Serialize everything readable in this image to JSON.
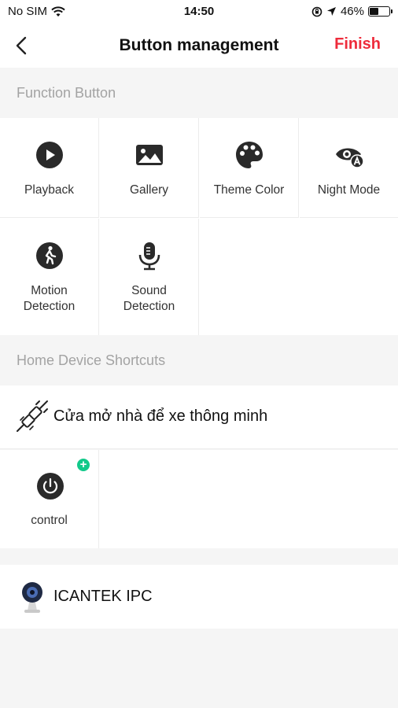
{
  "status_bar": {
    "carrier": "No SIM",
    "time": "14:50",
    "battery_percent": "46%",
    "battery_level": 0.46
  },
  "nav": {
    "title": "Button management",
    "finish_label": "Finish"
  },
  "function_section": {
    "header": "Function Button",
    "buttons": [
      {
        "label": "Playback",
        "icon": "play-icon"
      },
      {
        "label": "Gallery",
        "icon": "image-icon"
      },
      {
        "label": "Theme Color",
        "icon": "palette-icon"
      },
      {
        "label": "Night Mode",
        "icon": "night-mode-icon"
      },
      {
        "label": "Motion\nDetection",
        "icon": "motion-icon"
      },
      {
        "label": "Sound\nDetection",
        "icon": "microphone-icon"
      }
    ]
  },
  "shortcuts_section": {
    "header": "Home Device Shortcuts",
    "devices": [
      {
        "name": "Cửa mở nhà để xe thông minh",
        "icon": "plug-icon",
        "controls": [
          {
            "label": "control",
            "icon": "power-icon"
          }
        ]
      },
      {
        "name": "ICANTEK IPC",
        "icon": "camera-icon",
        "controls": []
      }
    ]
  },
  "colors": {
    "accent": "#ee2b3b",
    "add_badge": "#12c98a",
    "icon_dark": "#2a2a2a",
    "section_text": "#a3a3a3"
  }
}
